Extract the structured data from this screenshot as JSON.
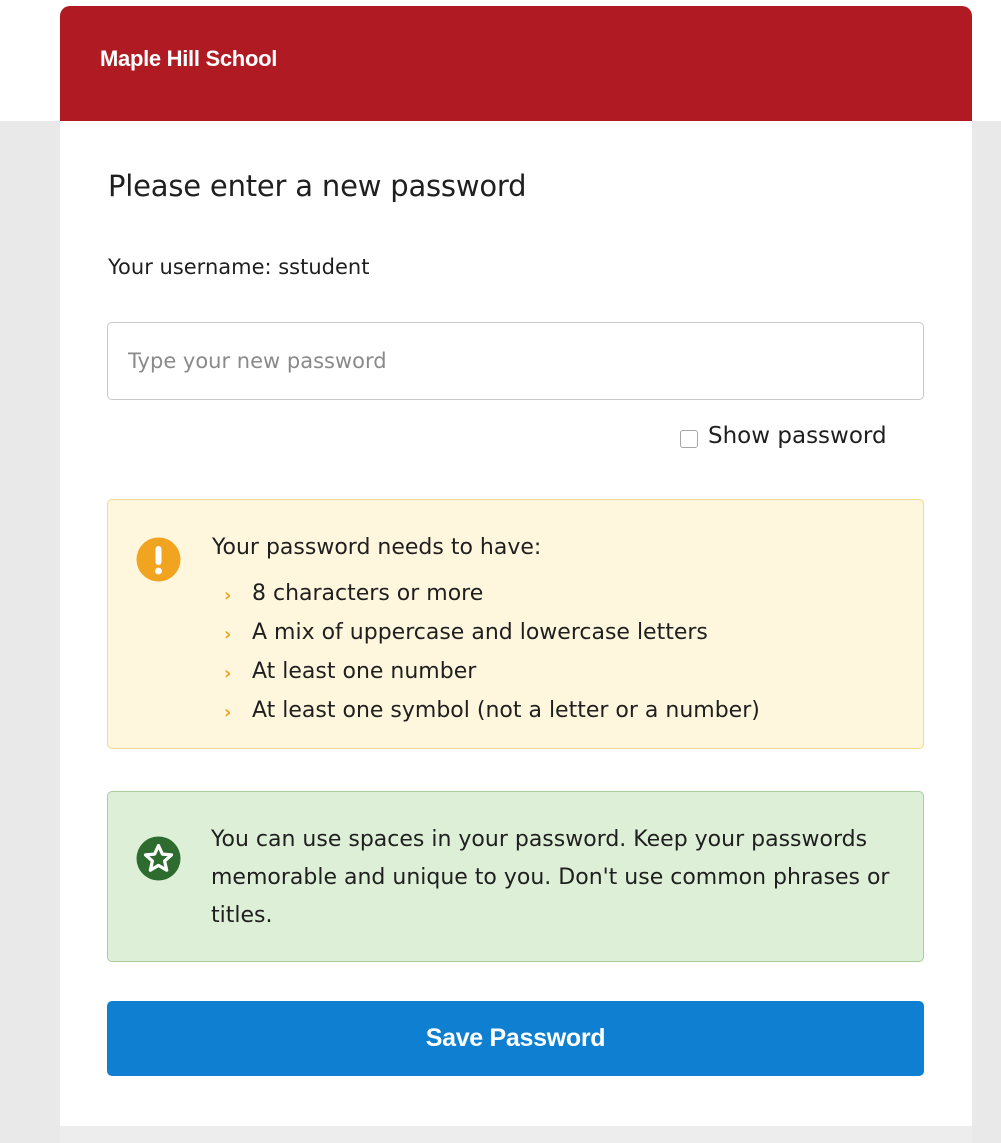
{
  "header": {
    "school_name": "Maple Hill School"
  },
  "form": {
    "title": "Please enter a new password",
    "username_line": "Your username: sstudent",
    "password_placeholder": "Type your new password",
    "password_value": "",
    "show_password_label": "Show password",
    "show_password_checked": false,
    "save_button_label": "Save Password"
  },
  "requirements": {
    "title": "Your password needs to have:",
    "items": [
      "8 characters or more",
      "A mix of uppercase and lowercase letters",
      "At least one number",
      "At least one symbol (not a letter or a number)"
    ]
  },
  "tip": {
    "text": "You can use spaces in your password. Keep your passwords memorable and unique to you. Don't use common phrases or titles."
  },
  "icons": {
    "warning": "exclamation-circle-icon",
    "tip": "star-circle-icon",
    "bullet": "chevron-right-icon"
  },
  "colors": {
    "header": "#b01b23",
    "warning_bg": "#fef7dd",
    "warning_accent": "#f0a420",
    "tip_bg": "#ddefd7",
    "tip_accent": "#2e6b2e",
    "button": "#0e7fd1"
  }
}
